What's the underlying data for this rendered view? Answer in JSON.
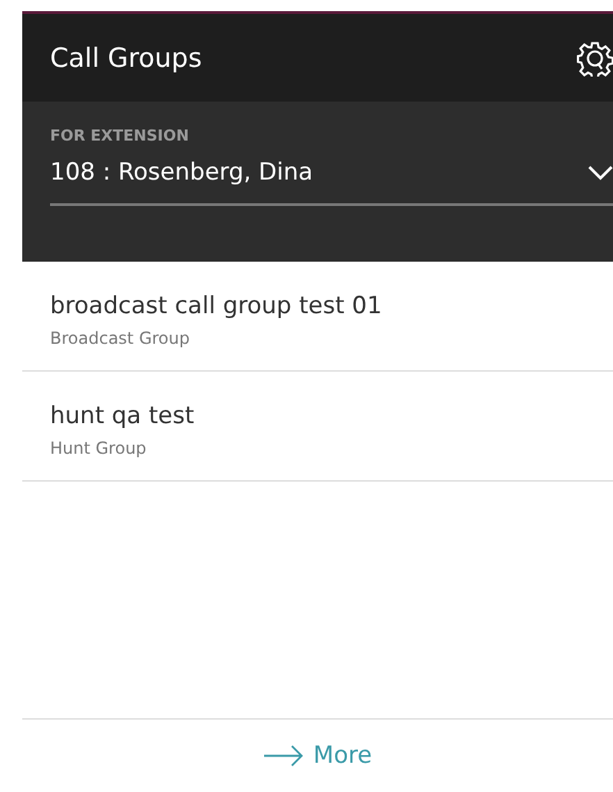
{
  "header": {
    "title": "Call Groups"
  },
  "extension": {
    "label": "FOR EXTENSION",
    "value": "108 : Rosenberg, Dina"
  },
  "groups": [
    {
      "name": "broadcast call group test 01",
      "type": "Broadcast Group"
    },
    {
      "name": "hunt qa test",
      "type": "Hunt Group"
    }
  ],
  "more": {
    "label": "More"
  }
}
